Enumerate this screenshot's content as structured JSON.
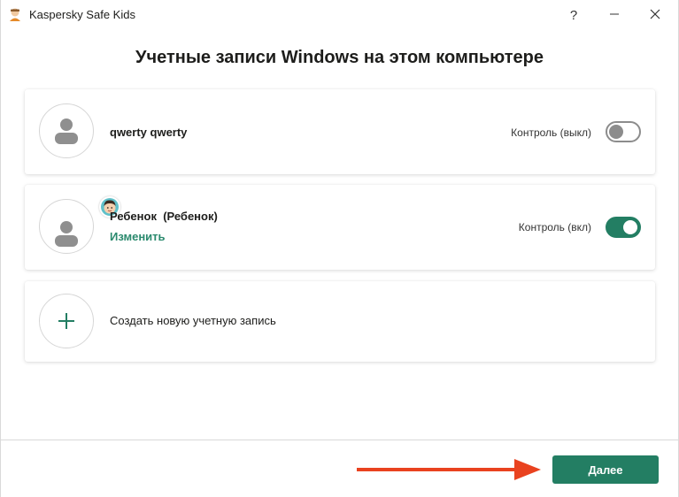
{
  "window": {
    "title": "Kaspersky Safe Kids",
    "help_symbol": "?",
    "minimize_symbol": "—",
    "close_symbol": "✕"
  },
  "heading": "Учетные записи Windows на этом компьютере",
  "accounts": [
    {
      "name": "qwerty qwerty",
      "control_label": "Контроль (выкл)",
      "control_on": false,
      "icon": "user-avatar-icon"
    },
    {
      "name": "Ребенок  (Ребенок)",
      "edit_label": "Изменить",
      "control_label": "Контроль (вкл)",
      "control_on": true,
      "icon": "user-avatar-icon",
      "badge_icon": "child-face-icon"
    }
  ],
  "create_account": {
    "label": "Создать новую учетную запись",
    "icon": "plus-icon"
  },
  "footer": {
    "next_label": "Далее"
  },
  "colors": {
    "accent": "#237e63",
    "link": "#2b8a6e",
    "toggle_off": "#8c8c8c",
    "arrow": "#e9421f"
  }
}
